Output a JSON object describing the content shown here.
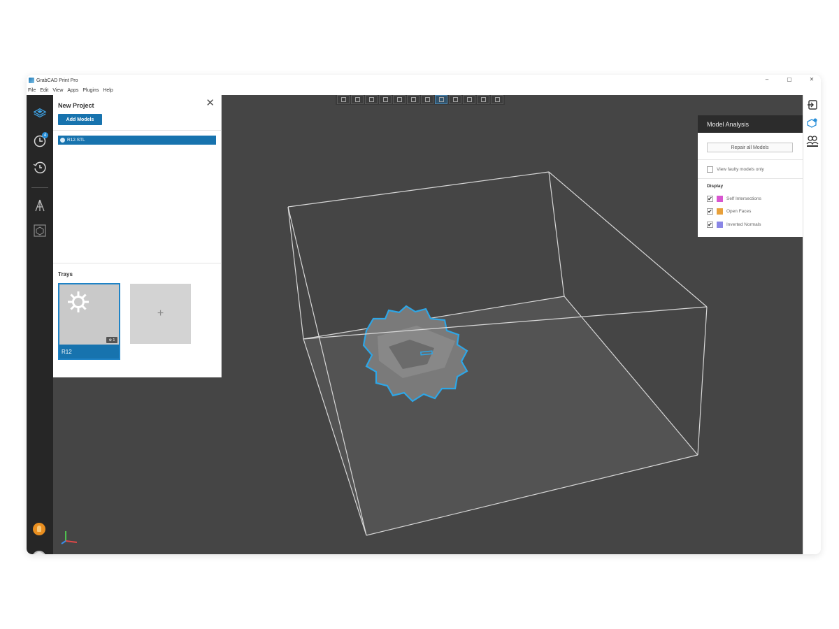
{
  "window": {
    "title": "GrabCAD Print Pro",
    "controls": [
      "–",
      "▢",
      "✕"
    ]
  },
  "menu": [
    "File",
    "Edit",
    "View",
    "Apps",
    "Plugins",
    "Help"
  ],
  "left_rail": {
    "icons": [
      "build-plate-icon",
      "schedule-icon",
      "history-icon",
      "support-icon",
      "layout-icon"
    ],
    "schedule_badge": "4"
  },
  "viewport": {
    "toolbar_icons": [
      "view-front-icon",
      "view-back-icon",
      "view-left-icon",
      "view-right-icon",
      "view-top-icon",
      "view-bottom-icon",
      "view-iso-icon",
      "view-fit-icon",
      "view-screen-icon",
      "camera-1-icon",
      "camera-2-icon",
      "camera-3-icon"
    ],
    "active_tool": 7
  },
  "project_panel": {
    "title": "New Project",
    "close": "✕",
    "add_models_label": "Add Models",
    "model_item": "R12.STL",
    "trays_label": "Trays",
    "tray_name": "R12",
    "tray_count": "1",
    "add_tray": "+"
  },
  "analysis": {
    "title": "Model Analysis",
    "repair_label": "Repair all Models",
    "faulty_label": "View faulty models only",
    "display_label": "Display",
    "display_items": [
      {
        "label": "Self Intersections",
        "color": "#d856d0",
        "checked": true
      },
      {
        "label": "Open Faces",
        "color": "#e8a03a",
        "checked": true
      },
      {
        "label": "Inverted Normals",
        "color": "#8a86e6",
        "checked": true
      }
    ]
  },
  "right_rail": {
    "icons": [
      "exit-panel-icon",
      "model-analysis-icon",
      "people-icon"
    ]
  },
  "colors": {
    "accent": "#1773ae",
    "highlight": "#2ea6e6",
    "viewport": "#454545"
  }
}
